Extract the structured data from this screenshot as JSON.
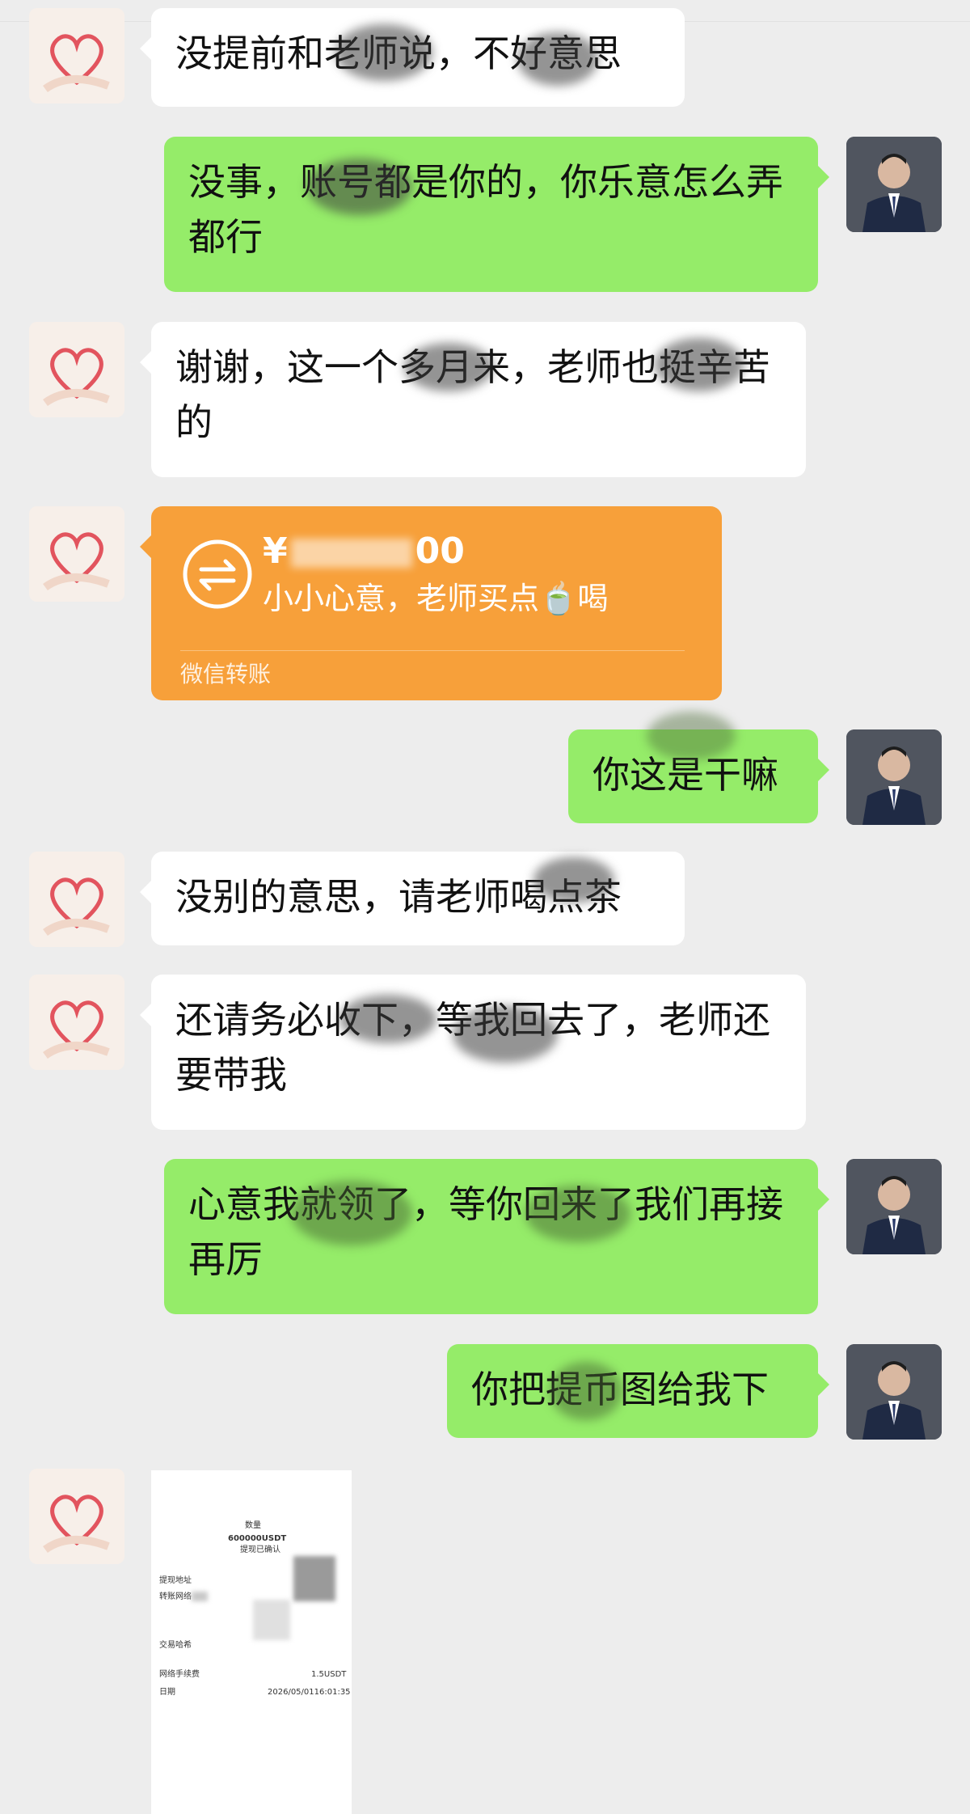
{
  "chat": {
    "messages": [
      {
        "side": "left",
        "text": "没提前和老师说，不好意思"
      },
      {
        "side": "right",
        "text": "没事，账号都是你的，你乐意怎么弄都行"
      },
      {
        "side": "left",
        "text": "谢谢，这一个多月来，老师也挺辛苦的"
      },
      {
        "side": "right",
        "text": "你这是干嘛"
      },
      {
        "side": "left",
        "text": "没别的意思，请老师喝点茶"
      },
      {
        "side": "left",
        "text": "还请务必收下，等我回去了，老师还要带我"
      },
      {
        "side": "right",
        "text": "心意我就领了，等你回来了我们再接再厉"
      },
      {
        "side": "right",
        "text": "你把提币图给我下"
      }
    ],
    "transfer": {
      "amount": "¥",
      "amount_tail": "00",
      "memo": "小小心意，老师买点🍵喝",
      "label": "微信转账"
    },
    "receipt": {
      "qty_label": "数量",
      "qty_value": "600000USDT",
      "status": "提现已确认",
      "addr_label": "提现地址",
      "net_label": "转账网络",
      "tx_label": "交易哈希",
      "fee_label": "网络手续费",
      "fee_value": "1.5USDT",
      "date_label": "日期",
      "date_value": "2026/05/0116:01:35"
    }
  }
}
